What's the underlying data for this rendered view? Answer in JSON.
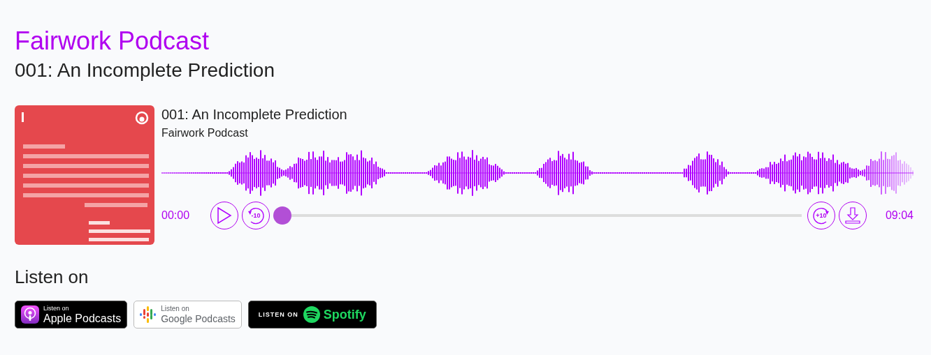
{
  "podcast_title": "Fairwork Podcast",
  "episode_heading": "001: An Incomplete Prediction",
  "player": {
    "episode_title": "001: An Incomplete Prediction",
    "podcast_name": "Fairwork Podcast",
    "elapsed": "00:00",
    "rewind_label": "-10",
    "progress": {
      "level": 0
    },
    "forward_label": "+10",
    "duration": "09:04"
  },
  "listen_heading": "Listen on",
  "platforms": [
    {
      "kind": "apple",
      "caption": "Listen on",
      "name": "Apple Podcasts"
    },
    {
      "kind": "google",
      "caption": "Listen on",
      "name": "Google Podcasts"
    },
    {
      "kind": "spotify",
      "caption": "LISTEN ON",
      "name": "Spotify"
    }
  ]
}
